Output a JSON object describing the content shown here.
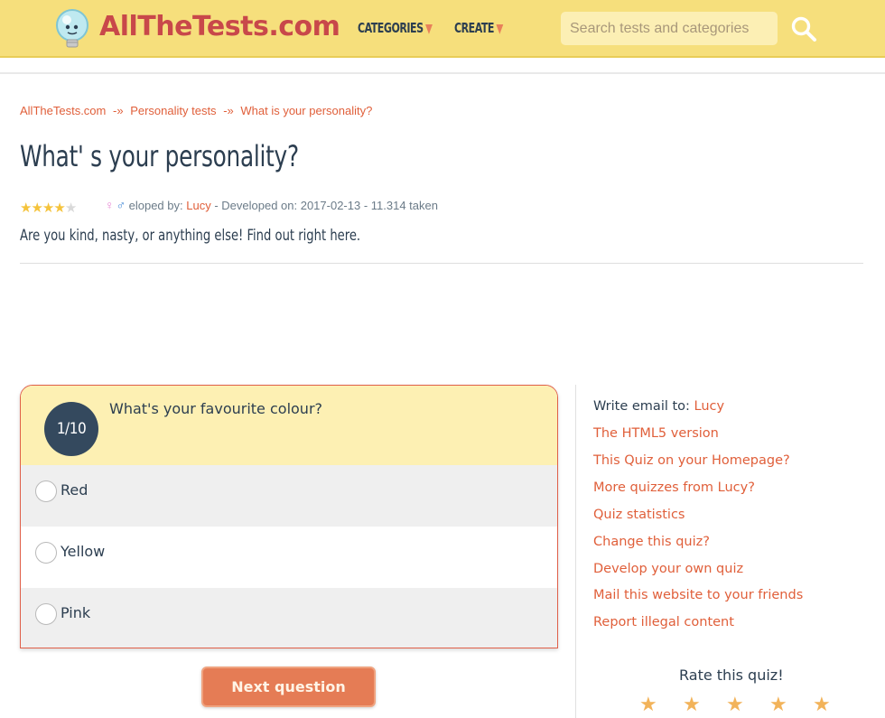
{
  "header": {
    "logo_text": "AllTheTests.com",
    "nav": [
      {
        "label": "CATEGORIES"
      },
      {
        "label": "CREATE"
      }
    ],
    "search_placeholder": "Search tests and categories"
  },
  "breadcrumb": {
    "items": [
      "AllTheTests.com",
      "Personality tests",
      "What is your personality?"
    ],
    "separator": "-»"
  },
  "quiz": {
    "title": "What' s your personality?",
    "meta_prefix": "eloped by:",
    "author": "Lucy",
    "meta_suffix": " - Developed on: 2017-02-13 - 11.314 taken",
    "rating_stars": 4,
    "description": "Are you kind, nasty, or anything else! Find out right here."
  },
  "question": {
    "counter": "1/10",
    "text": "What's your favourite colour?",
    "options": [
      "Red",
      "Yellow",
      "Pink"
    ],
    "next_label": "Next question"
  },
  "sidebar": {
    "email_label": "Write email to:",
    "email_author": "Lucy",
    "links": [
      "The HTML5 version",
      "This Quiz on your Homepage?",
      "More quizzes from Lucy?",
      "Quiz statistics",
      "Change this quiz?",
      "Develop your own quiz",
      "Mail this website to your friends",
      "Report illegal content"
    ],
    "rate_title": "Rate this quiz!",
    "rate_star_count": 5
  },
  "colors": {
    "header_bg": "#f6df7c",
    "accent": "#e05f3a",
    "badge_bg": "#34495e",
    "question_head_bg": "#fdf0b3",
    "button_bg": "#e57c55"
  }
}
